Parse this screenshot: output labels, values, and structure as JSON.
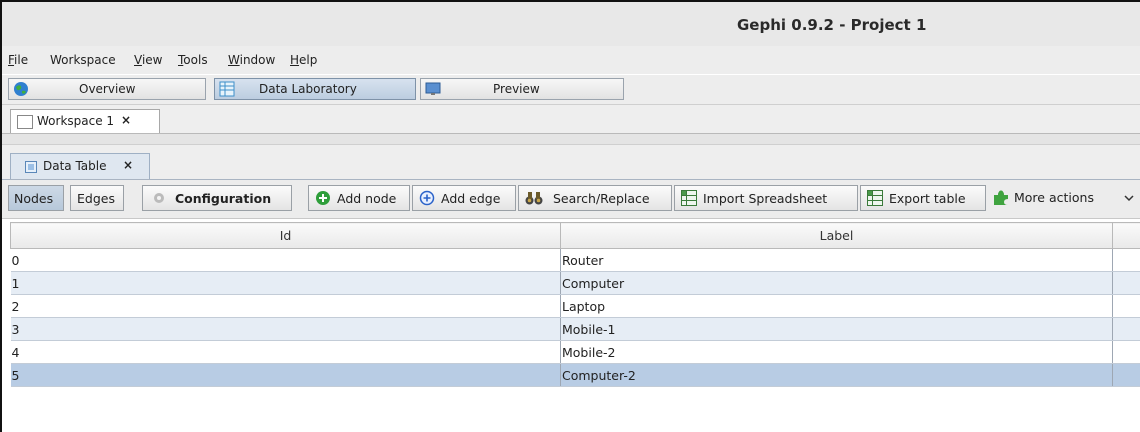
{
  "window": {
    "title": "Gephi 0.9.2 - Project 1"
  },
  "menu": [
    {
      "label": "File",
      "u": "F",
      "rest": "ile"
    },
    {
      "label": "Workspace",
      "u": "",
      "rest": "Workspace"
    },
    {
      "label": "View",
      "u": "V",
      "rest": "iew"
    },
    {
      "label": "Tools",
      "u": "T",
      "rest": "ools"
    },
    {
      "label": "Window",
      "u": "W",
      "rest": "indow"
    },
    {
      "label": "Help",
      "u": "H",
      "rest": "elp"
    }
  ],
  "perspectives": {
    "overview": "Overview",
    "data_lab": "Data Laboratory",
    "preview": "Preview"
  },
  "workspace_tab": {
    "label": "Workspace 1",
    "close": "×"
  },
  "data_table_tab": {
    "label": "Data Table",
    "close": "×"
  },
  "toolbar": {
    "nodes": "Nodes",
    "edges": "Edges",
    "configuration": "Configuration",
    "add_node": "Add node",
    "add_edge": "Add edge",
    "search_replace": "Search/Replace",
    "import": "Import Spreadsheet",
    "export": "Export table",
    "more": "More actions"
  },
  "table": {
    "headers": {
      "id": "Id",
      "label": "Label"
    },
    "rows": [
      {
        "id": "0",
        "label": "Router"
      },
      {
        "id": "1",
        "label": "Computer"
      },
      {
        "id": "2",
        "label": "Laptop"
      },
      {
        "id": "3",
        "label": "Mobile-1"
      },
      {
        "id": "4",
        "label": "Mobile-2"
      },
      {
        "id": "5",
        "label": "Computer-2"
      }
    ],
    "selected_row": "5"
  },
  "colors": {
    "selected_row": "#b8cce4",
    "alt_row": "#e6edf5",
    "add_node_green": "#2e9e3a",
    "add_edge_blue": "#2a62c9"
  }
}
